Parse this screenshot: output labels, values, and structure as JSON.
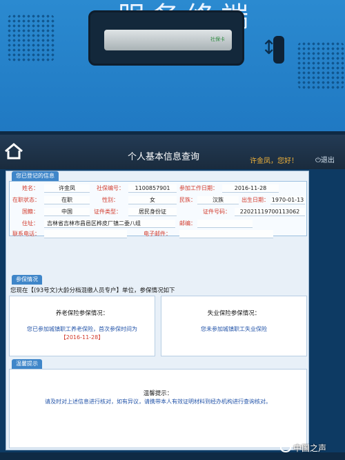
{
  "kiosk": {
    "title_fragment": "服务终端",
    "card_slot_label": "社保卡"
  },
  "topbar": {
    "title": "个人基本信息查询",
    "greeting": "许金凤，您好！",
    "logout": "退出"
  },
  "info": {
    "section_label": "您已登记的信息",
    "name_label": "姓名：",
    "name_value": "许金凤",
    "ss_no_label": "社保编号：",
    "ss_no_value": "1100857901",
    "work_date_label": "参加工作日期：",
    "work_date_value": "2016-11-28",
    "job_status_label": "在职状态：",
    "job_status_value": "在职",
    "gender_label": "性别：",
    "gender_value": "女",
    "ethnicity_label": "民族：",
    "ethnicity_value": "汉族",
    "birth_label": "出生日期：",
    "birth_value": "1970-01-13",
    "nationality_label": "国籍：",
    "nationality_value": "中国",
    "id_type_label": "证件类型：",
    "id_type_value": "居民身份证",
    "id_no_label": "证件号码：",
    "id_no_value": "22021119700113062",
    "address_label": "住址：",
    "address_value": "吉林省吉林市昌邑区桦皮厂镇二委八组",
    "postcode_label": "邮编：",
    "postcode_value": "",
    "phone_label": "联系电话：",
    "phone_value": "",
    "email_label": "电子邮件：",
    "email_value": ""
  },
  "insurance": {
    "section_label": "参保情况",
    "status_line": "您现在【(93号文)大龄分档混缴人员专户】单位，参保情况如下",
    "pension_title": "养老保险参保情况：",
    "pension_text": "您已参加城镇职工养老保险，首次参保时间为",
    "pension_date": "【2016-11-28】",
    "unemployment_title": "失业保险参保情况：",
    "unemployment_text": "您未参加城镇职工失业保险"
  },
  "tip": {
    "section_label": "温馨提示",
    "title": "温馨提示：",
    "text": "请及时对上述信息进行核对，如有异议，请携带本人有效证明材料到经办机构进行查询核对。"
  },
  "watermark": "中国之声"
}
